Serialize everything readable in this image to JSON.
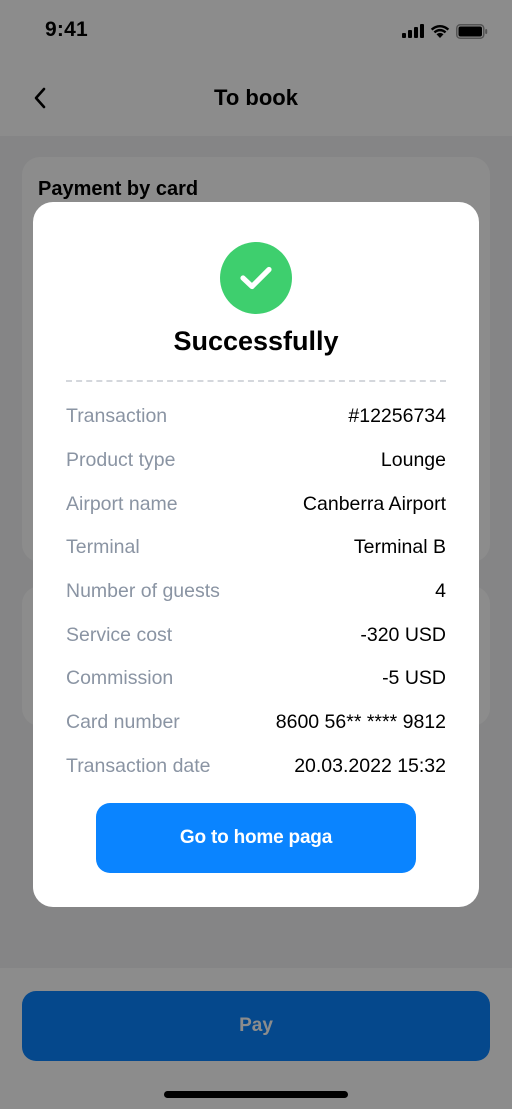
{
  "status_bar": {
    "time": "9:41"
  },
  "nav": {
    "title": "To book"
  },
  "background": {
    "card_title": "Payment by card",
    "pay_label": "Pay"
  },
  "modal": {
    "title": "Successfully",
    "rows": [
      {
        "label": "Transaction",
        "value": "#12256734"
      },
      {
        "label": "Product type",
        "value": "Lounge"
      },
      {
        "label": "Airport name",
        "value": "Canberra Airport"
      },
      {
        "label": "Terminal",
        "value": "Terminal B"
      },
      {
        "label": "Number of guests",
        "value": "4"
      },
      {
        "label": "Service cost",
        "value": "-320 USD"
      },
      {
        "label": "Commission",
        "value": "-5 USD"
      },
      {
        "label": "Card number",
        "value": "8600 56** **** 9812"
      },
      {
        "label": "Transaction date",
        "value": "20.03.2022 15:32"
      }
    ],
    "home_button_label": "Go to home paga"
  },
  "colors": {
    "accent": "#0a84ff",
    "success": "#3ecf6e",
    "label_gray": "#8a94a3"
  },
  "icons": {
    "back": "chevron-left-icon",
    "success": "checkmark-icon",
    "signal": "cellular-signal-icon",
    "wifi": "wifi-icon",
    "battery": "battery-icon"
  }
}
